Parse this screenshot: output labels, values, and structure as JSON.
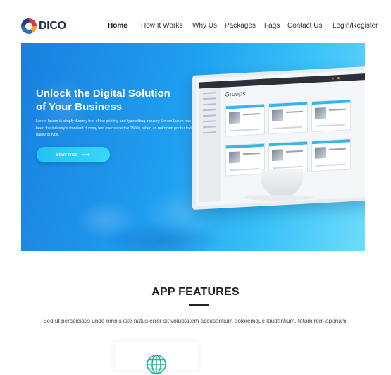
{
  "header": {
    "logo_text": "DICO",
    "nav": [
      {
        "label": "Home",
        "active": true
      },
      {
        "label": "How It Works"
      },
      {
        "label": "Why Us"
      },
      {
        "label": "Packages"
      },
      {
        "label": "Faqs"
      },
      {
        "label": "Contact Us"
      },
      {
        "label": "Login/Register"
      }
    ]
  },
  "hero": {
    "title_line1": "Unlock the Digital Solution",
    "title_line2": "of Your Business",
    "text": "Lorem Ipsum is simply dummy text of the printing and typesetting industry. Lorem Ipsum has been the industry's standard dummy text ever since the 1500s, when an unknown printer took a galley of type.",
    "button_label": "Start Trial",
    "button_icon": "arrow-right-icon",
    "screen_title": "Groups"
  },
  "features": {
    "title_light": "APP",
    "title_bold": "FEATURES",
    "description": "Sed ut perspiciatis unde omnis iste natus error sit voluptatem accusantium doloremque laudantium, totam rem aperiam.",
    "first_card_icon": "globe-icon"
  },
  "colors": {
    "hero_gradient_start": "#1a7fe0",
    "hero_gradient_end": "#6fdcfb",
    "button": "#21c3f5",
    "feature_icon": "#1fb59a"
  }
}
